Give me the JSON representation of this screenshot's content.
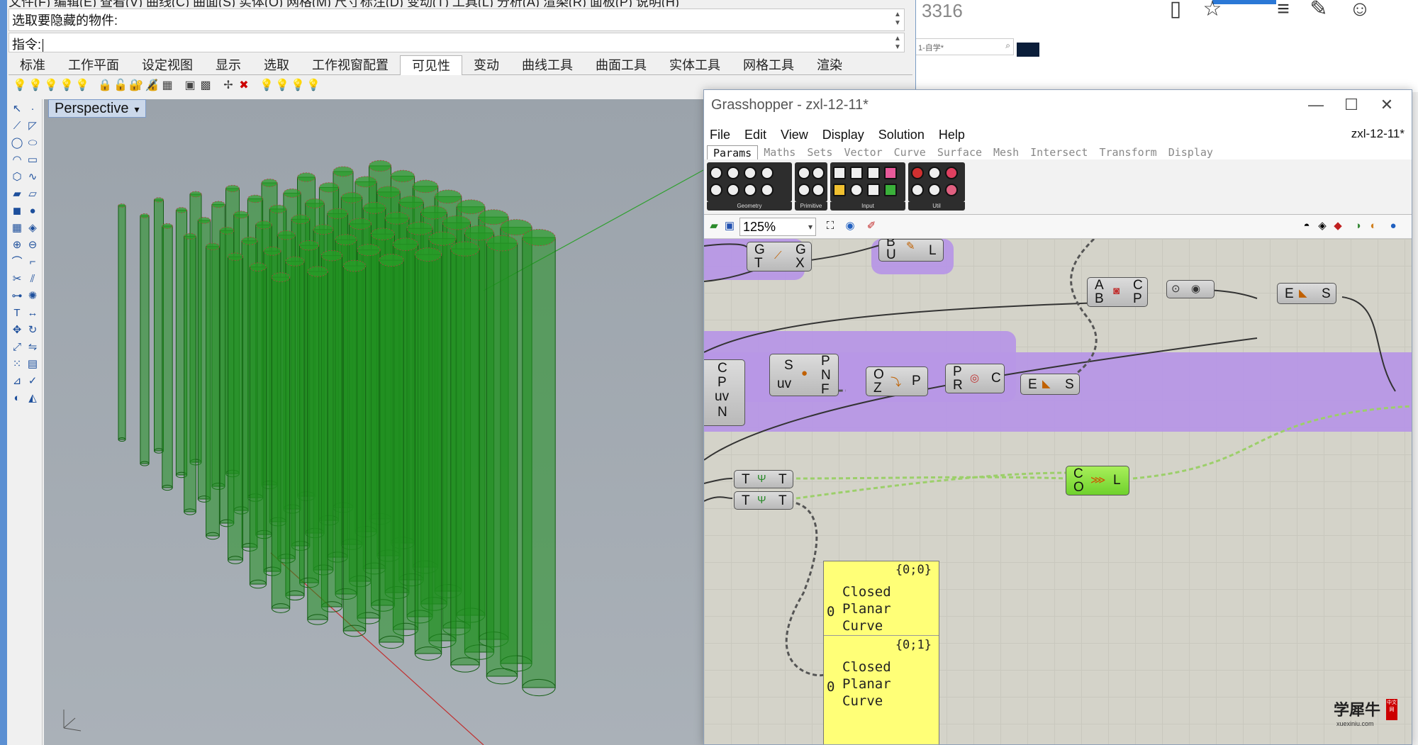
{
  "browser": {
    "tab_text": "3316",
    "address_text": "1-自学*",
    "search_icon": "search-icon"
  },
  "rhino": {
    "menubar": "文件(F)  编辑(E)  查看(V)  曲线(C)  曲面(S)  实体(O)  网格(M)  尺寸标注(D)  变动(T)  工具(L)  分析(A)  渲染(R)  面板(P)  说明(H)",
    "command_prompt": "选取要隐藏的物件:",
    "command_label": "指令:",
    "tabs": [
      {
        "label": "标准"
      },
      {
        "label": "工作平面"
      },
      {
        "label": "设定视图"
      },
      {
        "label": "显示"
      },
      {
        "label": "选取"
      },
      {
        "label": "工作视窗配置"
      },
      {
        "label": "可见性"
      },
      {
        "label": "变动"
      },
      {
        "label": "曲线工具"
      },
      {
        "label": "曲面工具"
      },
      {
        "label": "实体工具"
      },
      {
        "label": "网格工具"
      },
      {
        "label": "渲染"
      }
    ],
    "active_tab": "可见性",
    "viewport_name": "Perspective",
    "pipe_color": "#1f8f1f",
    "axis_x_color": "#c03030",
    "axis_y_color": "#30a030"
  },
  "gh": {
    "title": "Grasshopper - zxl-12-11*",
    "doc_name": "zxl-12-11*",
    "menu": [
      "File",
      "Edit",
      "View",
      "Display",
      "Solution",
      "Help"
    ],
    "categories": [
      "Params",
      "Maths",
      "Sets",
      "Vector",
      "Curve",
      "Surface",
      "Mesh",
      "Intersect",
      "Transform",
      "Display"
    ],
    "active_category": "Params",
    "ribbon_groups": [
      "Geometry",
      "Primitive",
      "Input",
      "Util"
    ],
    "zoom": "125%",
    "group_color": "#b797e6",
    "panel_color": "#ffff77",
    "nodes": {
      "gtx": {
        "l1": "G",
        "l2": "T",
        "r1": "G",
        "r2": "X"
      },
      "bul": {
        "l1": "B",
        "l2": "U",
        "r1": "L"
      },
      "abcp": {
        "l1": "A",
        "l2": "B",
        "r1": "C",
        "r2": "P"
      },
      "es1": {
        "l1": "E",
        "r1": "S"
      },
      "cpuvn": {
        "o1": "C",
        "o2": "P",
        "o3": "uv",
        "o4": "N"
      },
      "spnf": {
        "l1": "S",
        "l2": "uv",
        "r1": "P",
        "r2": "N",
        "r3": "F"
      },
      "ozp": {
        "l1": "O",
        "l2": "Z",
        "r1": "P"
      },
      "prc": {
        "l1": "P",
        "l2": "R",
        "r1": "C"
      },
      "es2": {
        "l1": "E",
        "r1": "S"
      },
      "tt1": {
        "l1": "T",
        "r1": "T"
      },
      "tt2": {
        "l1": "T",
        "r1": "T"
      },
      "col": {
        "l1": "C",
        "l2": "O",
        "r1": "L"
      }
    },
    "panel": {
      "p1": "{0;0}",
      "p2": "{0;1}",
      "i1": "0",
      "i2": "0",
      "a1": "Closed",
      "a2": "Planar",
      "a3": "Curve",
      "b1": "Closed",
      "b2": "Planar",
      "b3": "Curve"
    },
    "watermark": {
      "main": "学犀牛",
      "sub": "xuexiniu.com",
      "seal": "中文网"
    }
  }
}
